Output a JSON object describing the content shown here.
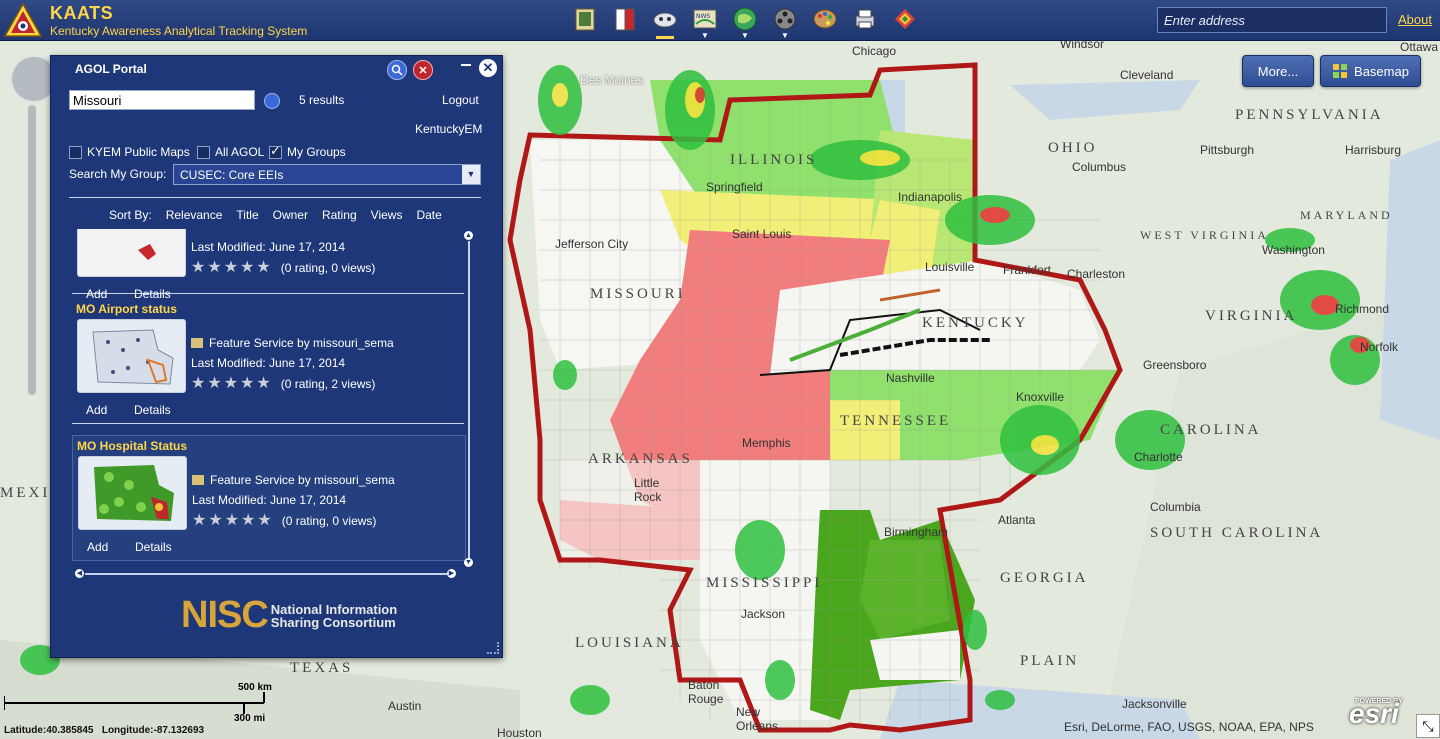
{
  "header": {
    "title": "KAATS",
    "subtitle": "Kentucky Awareness Analytical Tracking System",
    "address_placeholder": "Enter address",
    "about": "About",
    "toolbar": [
      {
        "name": "notebook-icon",
        "color": "#e2d6a3"
      },
      {
        "name": "book-icon",
        "color": "#c7262c"
      },
      {
        "name": "cloud-icon",
        "color": "#dfe4ee"
      },
      {
        "name": "weather-radar-icon",
        "color": "#e8e2c0"
      },
      {
        "name": "globe-icon",
        "color": "#3aa85b"
      },
      {
        "name": "film-reel-icon",
        "color": "#888888"
      },
      {
        "name": "palette-icon",
        "color": "#c99a5b"
      },
      {
        "name": "printer-icon",
        "color": "#cfd8e6"
      },
      {
        "name": "layers-icon",
        "color": "#d8443b"
      }
    ]
  },
  "map_buttons": {
    "more": "More...",
    "basemap": "Basemap"
  },
  "panel": {
    "title": "AGOL Portal",
    "search_value": "Missouri",
    "results_count": "5 results",
    "logout": "Logout",
    "user": "KentuckyEM",
    "checkboxes": [
      {
        "label": "KYEM Public Maps",
        "checked": false
      },
      {
        "label": "All AGOL",
        "checked": false
      },
      {
        "label": "My Groups",
        "checked": true
      }
    ],
    "group_label": "Search My Group:",
    "group_value": "CUSEC: Core EEIs",
    "sort_label": "Sort By:",
    "sort_options": [
      "Relevance",
      "Title",
      "Owner",
      "Rating",
      "Views",
      "Date"
    ],
    "results": [
      {
        "title": "",
        "type": "",
        "modified": "Last Modified: June 17, 2014",
        "rating": "(0 rating, 0 views)",
        "add": "Add",
        "details": "Details"
      },
      {
        "title": "MO Airport status",
        "type": "Feature Service by missouri_sema",
        "modified": "Last Modified: June 17, 2014",
        "rating": "(0 rating, 2 views)",
        "add": "Add",
        "details": "Details"
      },
      {
        "title": "MO Hospital Status",
        "type": "Feature Service by missouri_sema",
        "modified": "Last Modified: June 17, 2014",
        "rating": "(0 rating, 0 views)",
        "add": "Add",
        "details": "Details"
      }
    ],
    "logo_mark": "NISC",
    "logo_line1": "National Information",
    "logo_line2": "Sharing Consortium"
  },
  "map_labels": {
    "states": [
      "MISSOURI",
      "ILLINOIS",
      "KENTUCKY",
      "TENNESSEE",
      "ARKANSAS",
      "LOUISIANA",
      "MISSISSIPPI",
      "GEORGIA",
      "SOUTH CAROLINA",
      "OHIO",
      "WEST VIRGINIA",
      "VIRGINIA",
      "PENNSYLVANIA",
      "MARYLAND",
      "TEXAS",
      "MEXICO",
      "PLAIN",
      "CAROLINA"
    ],
    "cities": [
      "Chicago",
      "Windsor",
      "Cleveland",
      "Columbus",
      "Pittsburgh",
      "Harrisburg",
      "Springfield",
      "Indianapolis",
      "Saint Louis",
      "Frankfort",
      "Charleston",
      "Jefferson City",
      "Louisville",
      "Nashville",
      "Knoxville",
      "Memphis",
      "Little Rock",
      "Atlanta",
      "Birmingham",
      "Jackson",
      "Columbia",
      "Greensboro",
      "Charlotte",
      "Washington",
      "Richmond",
      "Norfolk",
      "Baton Rouge",
      "New Orleans",
      "Jacksonville",
      "Austin",
      "Houston",
      "Des Moines",
      "Ottawa"
    ]
  },
  "footer": {
    "scale_km": "500 km",
    "scale_mi": "300 mi",
    "latitude": "Latitude:40.385845",
    "longitude": "Longitude:-87.132693",
    "attribution": "Esri, DeLorme, FAO, USGS, NOAA, EPA, NPS",
    "powered": "POWERED BY",
    "esri": "esri"
  }
}
